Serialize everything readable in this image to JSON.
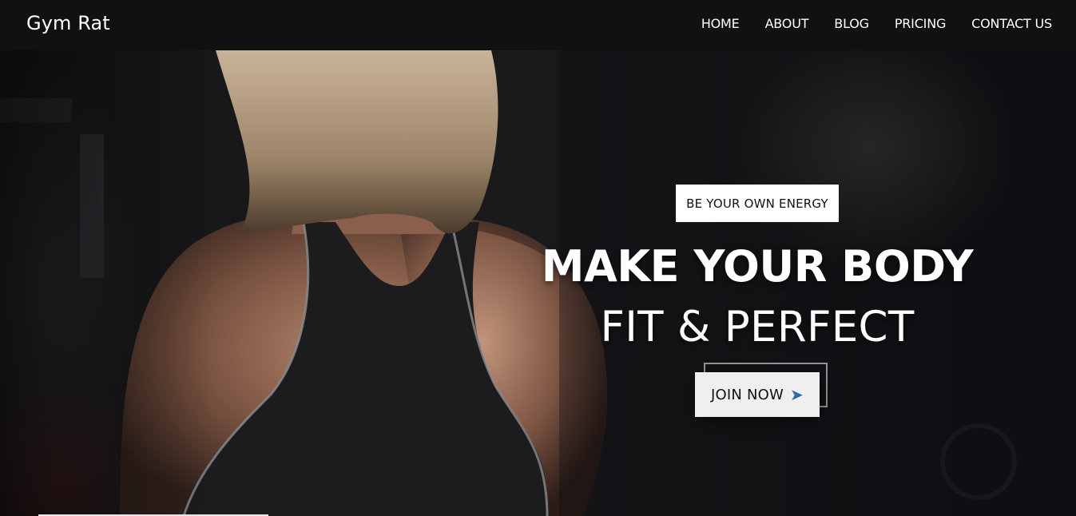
{
  "header": {
    "brand": "Gym Rat",
    "nav": [
      {
        "label": "HOME"
      },
      {
        "label": "ABOUT"
      },
      {
        "label": "BLOG"
      },
      {
        "label": "PRICING"
      },
      {
        "label": "CONTACT US"
      }
    ]
  },
  "hero": {
    "tagline": "BE YOUR OWN ENERGY",
    "headline_line1": "MAKE YOUR BODY",
    "headline_line2": "FIT & PERFECT",
    "cta_label": "JOIN NOW",
    "cta_icon": "arrow-right-icon"
  },
  "colors": {
    "header_bg": "#111111",
    "cta_bg": "#efefef",
    "cta_arrow": "#2c6aa8",
    "text": "#ffffff"
  }
}
